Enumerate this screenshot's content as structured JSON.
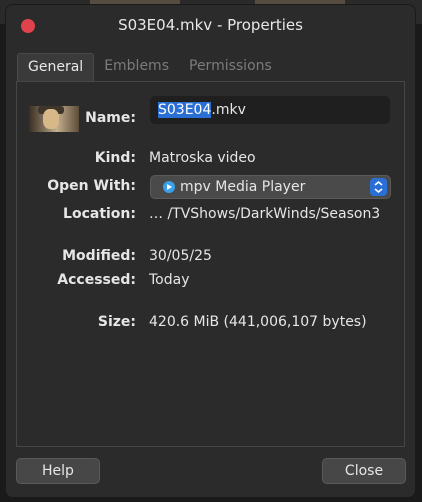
{
  "window": {
    "title": "S03E04.mkv - Properties"
  },
  "tabs": [
    {
      "label": "General",
      "active": true
    },
    {
      "label": "Emblems",
      "active": false
    },
    {
      "label": "Permissions",
      "active": false
    }
  ],
  "general": {
    "name_label": "Name:",
    "name_selected": "S03E04",
    "name_ext": ".mkv",
    "kind_label": "Kind:",
    "kind_value": "Matroska video",
    "open_with_label": "Open With:",
    "open_with_value": "mpv Media Player",
    "open_with_icon": "mpv-icon",
    "location_label": "Location:",
    "location_value": "…  /TVShows/DarkWinds/Season3",
    "modified_label": "Modified:",
    "modified_value": "30/05/25",
    "accessed_label": "Accessed:",
    "accessed_value": "Today",
    "size_label": "Size:",
    "size_value": "420.6 MiB (441,006,107 bytes)"
  },
  "buttons": {
    "help": "Help",
    "close": "Close"
  },
  "colors": {
    "accent": "#2a6fd6",
    "close_dot": "#e0434b"
  }
}
